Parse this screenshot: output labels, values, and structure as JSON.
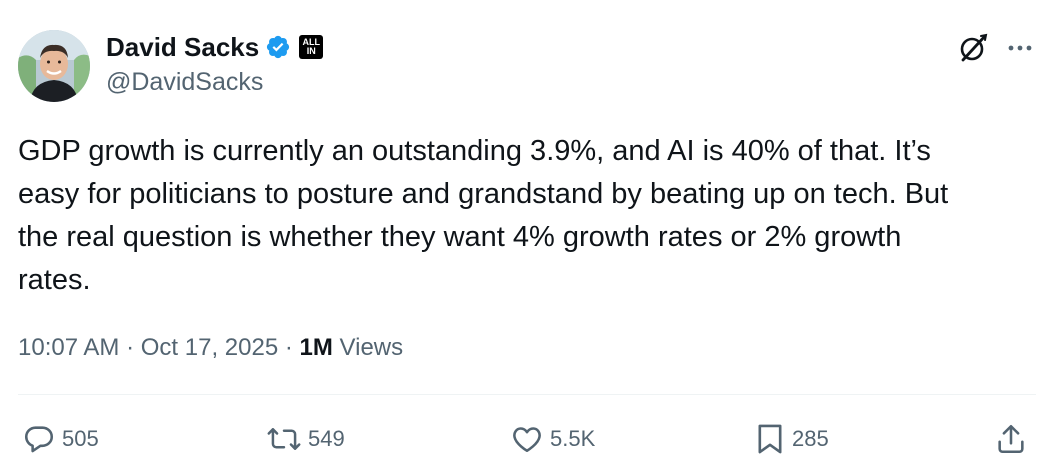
{
  "author": {
    "display_name": "David Sacks",
    "handle": "@DavidSacks",
    "verified_icon": "verified-badge-icon",
    "affiliation_badge_line1": "ALL",
    "affiliation_badge_line2": "IN"
  },
  "tweet": {
    "text": "GDP growth is currently an outstanding 3.9%, and AI is 40% of that. It’s\neasy for politicians to posture and grandstand by beating up on tech. But\nthe real question is whether they want 4% growth rates or 2% growth\nrates."
  },
  "meta": {
    "time": "10:07 AM",
    "separator": "·",
    "date": "Oct 17, 2025",
    "views_count": "1M",
    "views_label": "Views"
  },
  "actions": {
    "replies": "505",
    "reposts": "549",
    "likes": "5.5K",
    "bookmarks": "285"
  },
  "colors": {
    "text_primary": "#0f1419",
    "text_secondary": "#536471",
    "verified_blue": "#1d9bf0",
    "divider": "#eff3f4"
  },
  "icons": {
    "header": [
      "grok-icon",
      "more-icon"
    ],
    "actions": [
      "reply-icon",
      "repost-icon",
      "like-icon",
      "bookmark-icon",
      "share-icon"
    ]
  }
}
